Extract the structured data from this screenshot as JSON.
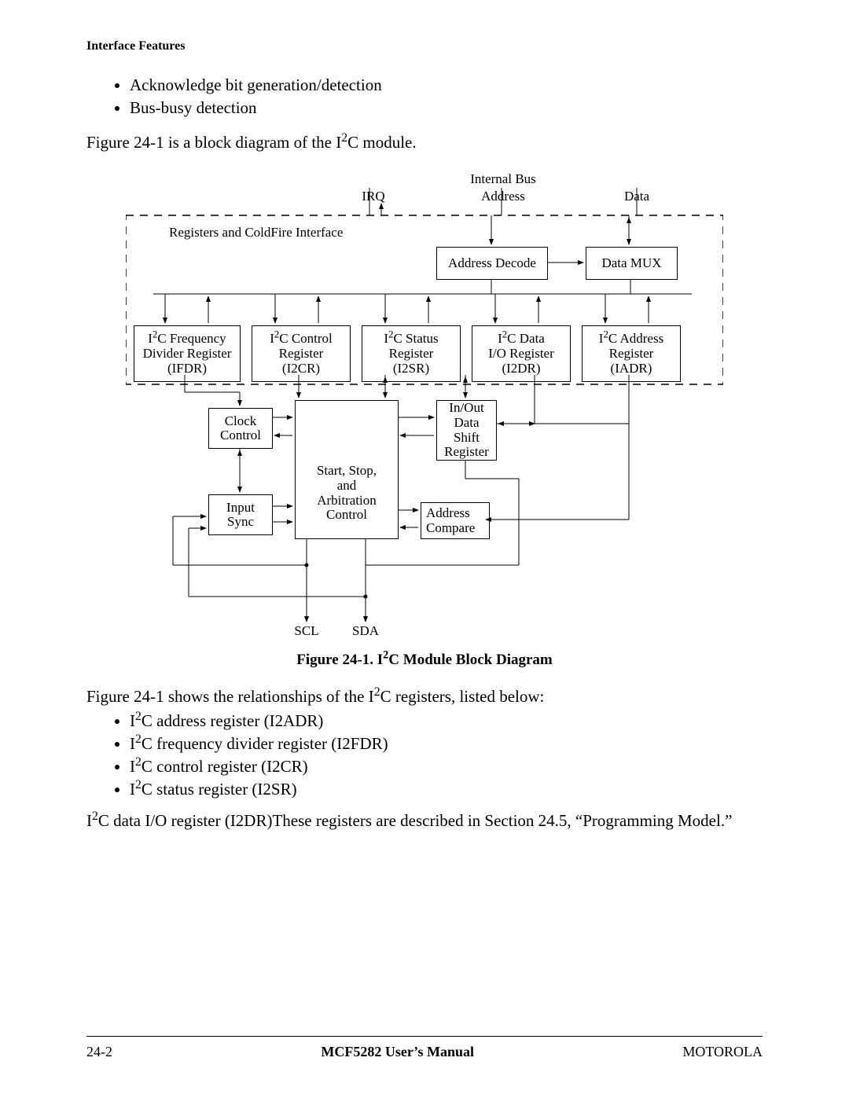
{
  "header": {
    "section": "Interface Features"
  },
  "top_bullets": [
    "Acknowledge bit generation/detection",
    "Bus-busy detection"
  ],
  "intro_line_pre": "Figure 24-1 is a block diagram of the I",
  "intro_line_post": "C module.",
  "diagram": {
    "internal_bus": "Internal Bus",
    "irq": "IRQ",
    "address": "Address",
    "data": "Data",
    "reg_iface": "Registers and ColdFire Interface",
    "addr_decode": "Address Decode",
    "data_mux": "Data MUX",
    "reg1_l1": "I",
    "reg1_l1b": "C Frequency",
    "reg1_l2": "Divider Register",
    "reg1_l3": "(IFDR)",
    "reg2_l1": "I",
    "reg2_l1b": "C Control",
    "reg2_l2": "Register",
    "reg2_l3": "(I2CR)",
    "reg3_l1": "I",
    "reg3_l1b": "C Status",
    "reg3_l2": "Register",
    "reg3_l3": "(I2SR)",
    "reg4_l1": "I",
    "reg4_l1b": "C Data",
    "reg4_l2": "I/O Register",
    "reg4_l3": "(I2DR)",
    "reg5_l1": "I",
    "reg5_l1b": "C Address",
    "reg5_l2": "Register",
    "reg5_l3": "(IADR)",
    "clock_ctrl": "Clock\nControl",
    "ssa": "Start, Stop,\nand\nArbitration\nControl",
    "inout": "In/Out\nData\nShift\nRegister",
    "input_sync": "Input\nSync",
    "addr_cmp": "Address\nCompare",
    "scl": "SCL",
    "sda": "SDA"
  },
  "figure_caption_pre": "Figure 24-1. I",
  "figure_caption_post": "C Module Block Diagram",
  "mid_para_pre": "Figure 24-1 shows the relationships of the I",
  "mid_para_post": "C registers, listed below:",
  "reg_bullets": [
    {
      "pre": "I",
      "post": "C address register (I2ADR)"
    },
    {
      "pre": "I",
      "post": "C frequency divider register (I2FDR)"
    },
    {
      "pre": "I",
      "post": "C control register (I2CR)"
    },
    {
      "pre": "I",
      "post": "C status register (I2SR)"
    }
  ],
  "bottom_para_pre": "I",
  "bottom_para_post": "C data I/O register (I2DR)These registers are described in Section 24.5, “Programming Model.”",
  "footer": {
    "page": "24-2",
    "title": "MCF5282 User’s Manual",
    "brand": "MOTOROLA"
  }
}
